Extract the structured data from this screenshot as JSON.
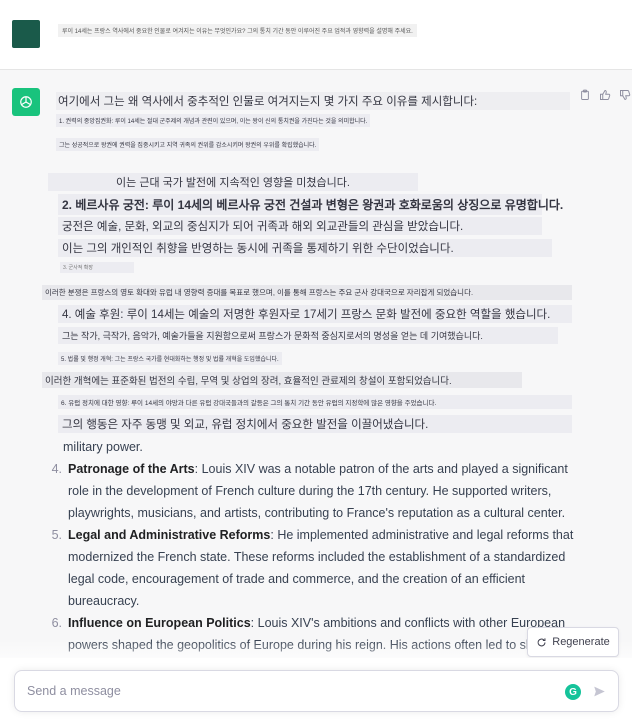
{
  "user_message": {
    "text": "루이 14세는 프랑스 역사에서 중요한 인물로 여겨지는 이유는 무엇인가요? 그의 통치 기간 동안 이루어진 주요 업적과 영향력을 설명해 주세요."
  },
  "assistant": {
    "ko_intro": "여기에서 그는 왜 역사에서 중추적인 인물로 여겨지는지 몇 가지 주요 이유를 제시합니다:",
    "ko_1": "1. 권력의 중앙집권화: 루이 14세는 절대 군주제의 개념과 관련이 있으며, 이는 왕이 신의 통치권을 가진다는 것을 의미합니다.",
    "ko_1b": "그는 성공적으로 왕권에 권력을 집중시키고 지역 귀족의 권위를 감소시키며 왕권의 우위를 확립했습니다.",
    "ko_1c": "이는 근대 국가 발전에 지속적인 영향을 미쳤습니다.",
    "ko_2": "2. 베르사유 궁전: 루이 14세의 베르사유 궁전 건설과 변형은 왕권과 호화로움의 상징으로 유명합니다.",
    "ko_2b": "궁전은 예술, 문화, 외교의 중심지가 되어 귀족과 해외 외교관들의 관심을 받았습니다.",
    "ko_2c": "이는 그의 개인적인 취향을 반영하는 동시에 귀족을 통제하기 위한 수단이었습니다.",
    "ko_2d": "3. 군사적 확장",
    "ko_3": "이러한 분쟁은 프랑스의 영토 확대와 유럽 내 영향력 증대를 목표로 했으며, 이를 통해 프랑스는 주요 군사 강대국으로 자리잡게 되었습니다.",
    "ko_4": "4. 예술 후원: 루이 14세는 예술의 저명한 후원자로 17세기 프랑스 문화 발전에 중요한 역할을 했습니다.",
    "ko_4b": "그는 작가, 극작가, 음악가, 예술가들을 지원함으로써 프랑스가 문화적 중심지로서의 명성을 얻는 데 기여했습니다.",
    "ko_5": "5. 법률 및 행정 개혁: 그는 프랑스 국가를 현대화하는 행정 및 법률 개혁을 도입했습니다.",
    "ko_5b": "이러한 개혁에는 표준화된 법전의 수립, 무역 및 상업의 장려, 효율적인 관료제의 창설이 포함되었습니다.",
    "ko_6": "6. 유럽 정치에 대한 영향: 루이 14세의 야망과 다른 유럽 강대국들과의 갈등은 그의 통치 기간 동안 유럽의 지정학에 많은 영향을 주었습니다.",
    "ko_6b": "그의 행동은 자주 동맹 및 외교, 유럽 정치에서 중요한 발전을 이끌어냈습니다.",
    "en_cont": "military power.",
    "en_items": [
      {
        "num": "4.",
        "title": "Patronage of the Arts",
        "text": ": Louis XIV was a notable patron of the arts and played a significant role in the development of French culture during the 17th century. He supported writers, playwrights, musicians, and artists, contributing to France's reputation as a cultural center."
      },
      {
        "num": "5.",
        "title": "Legal and Administrative Reforms",
        "text": ": He implemented administrative and legal reforms that modernized the French state. These reforms included the establishment of a standardized legal code, encouragement of trade and commerce, and the creation of an efficient bureaucracy."
      },
      {
        "num": "6.",
        "title": "Influence on European Politics",
        "text": ": Louis XIV's ambitions and conflicts with other European powers shaped the geopolitics of Europe during his reign. His actions often led to shifts in alliances, diplomacy, and significant developments in European politics."
      }
    ]
  },
  "regenerate_label": "Regenerate",
  "composer": {
    "placeholder": "Send a message"
  },
  "colors": {
    "gpt_green": "#19c37d",
    "user_avatar": "#1a5a4a",
    "grammarly": "#15c39a"
  },
  "icons": [
    "openai-logo-icon",
    "clipboard-icon",
    "thumbs-up-icon",
    "thumbs-down-icon",
    "refresh-icon",
    "grammarly-icon",
    "send-icon"
  ]
}
